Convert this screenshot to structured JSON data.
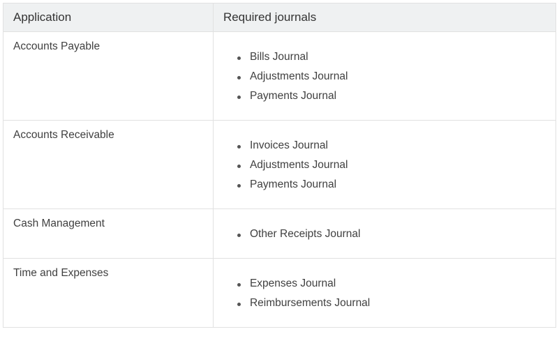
{
  "table": {
    "headers": {
      "application": "Application",
      "required_journals": "Required journals"
    },
    "rows": [
      {
        "application": "Accounts Payable",
        "journals": [
          "Bills Journal",
          "Adjustments Journal",
          "Payments Journal"
        ]
      },
      {
        "application": "Accounts Receivable",
        "journals": [
          "Invoices Journal",
          "Adjustments Journal",
          "Payments Journal"
        ]
      },
      {
        "application": "Cash Management",
        "journals": [
          "Other Receipts Journal"
        ]
      },
      {
        "application": "Time and Expenses",
        "journals": [
          "Expenses Journal",
          "Reimbursements Journal"
        ]
      }
    ]
  }
}
